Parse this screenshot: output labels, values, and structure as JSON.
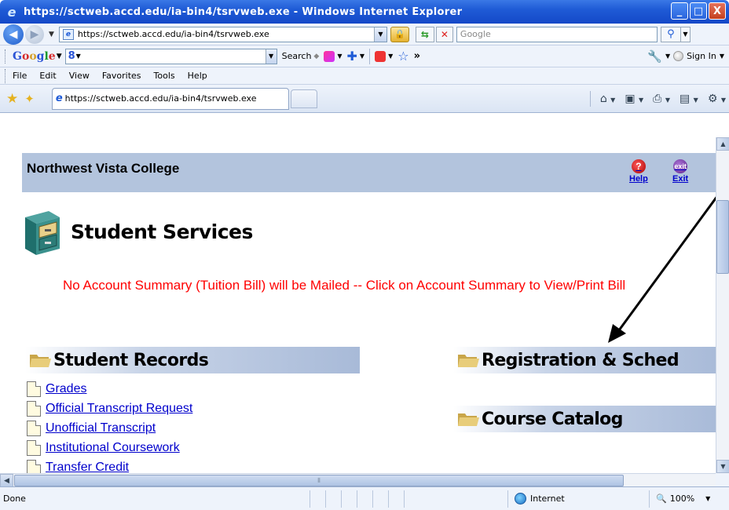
{
  "window": {
    "title": "https://sctweb.accd.edu/ia-bin4/tsrvweb.exe - Windows Internet Explorer",
    "controls": {
      "minimize": "_",
      "maximize": "□",
      "close": "X"
    }
  },
  "address_bar": {
    "url": "https://sctweb.accd.edu/ia-bin4/tsrvweb.exe",
    "search_placeholder": "Google"
  },
  "google_toolbar": {
    "logo": [
      "G",
      "o",
      "o",
      "g",
      "l",
      "e"
    ],
    "input_value": "8",
    "search_label": "Search",
    "more_label": "»",
    "signin_label": "Sign In"
  },
  "menu": {
    "items": [
      "File",
      "Edit",
      "View",
      "Favorites",
      "Tools",
      "Help"
    ]
  },
  "tab": {
    "title": "https://sctweb.accd.edu/ia-bin4/tsrvweb.exe"
  },
  "page": {
    "college_name": "Northwest Vista College",
    "help_label": "Help",
    "exit_label": "Exit",
    "heading": "Student Services",
    "notice": "No Account Summary (Tuition Bill) will be Mailed -- Click on Account Summary to View/Print Bill",
    "sections": {
      "records": "Student Records",
      "registration": "Registration & Sched",
      "catalog": "Course Catalog"
    },
    "record_links": [
      "Grades",
      "Official Transcript Request",
      "Unofficial Transcript",
      "Institutional Coursework",
      "Transfer Credit"
    ]
  },
  "status_bar": {
    "text": "Done",
    "zone": "Internet",
    "zoom": "100%"
  },
  "colors": {
    "header_band": "#b3c4dd",
    "notice": "#ff0000",
    "link": "#0000cc"
  }
}
